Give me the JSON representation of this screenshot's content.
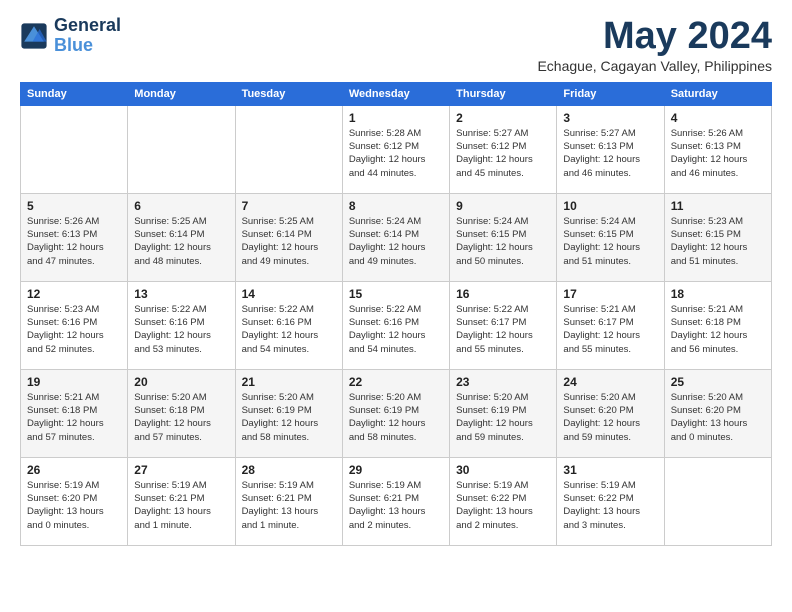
{
  "logo": {
    "line1": "General",
    "line2": "Blue"
  },
  "title": "May 2024",
  "subtitle": "Echague, Cagayan Valley, Philippines",
  "days_of_week": [
    "Sunday",
    "Monday",
    "Tuesday",
    "Wednesday",
    "Thursday",
    "Friday",
    "Saturday"
  ],
  "weeks": [
    [
      {
        "num": "",
        "sunrise": "",
        "sunset": "",
        "daylight": ""
      },
      {
        "num": "",
        "sunrise": "",
        "sunset": "",
        "daylight": ""
      },
      {
        "num": "",
        "sunrise": "",
        "sunset": "",
        "daylight": ""
      },
      {
        "num": "1",
        "sunrise": "5:28 AM",
        "sunset": "6:12 PM",
        "daylight": "12 hours and 44 minutes."
      },
      {
        "num": "2",
        "sunrise": "5:27 AM",
        "sunset": "6:12 PM",
        "daylight": "12 hours and 45 minutes."
      },
      {
        "num": "3",
        "sunrise": "5:27 AM",
        "sunset": "6:13 PM",
        "daylight": "12 hours and 46 minutes."
      },
      {
        "num": "4",
        "sunrise": "5:26 AM",
        "sunset": "6:13 PM",
        "daylight": "12 hours and 46 minutes."
      }
    ],
    [
      {
        "num": "5",
        "sunrise": "5:26 AM",
        "sunset": "6:13 PM",
        "daylight": "12 hours and 47 minutes."
      },
      {
        "num": "6",
        "sunrise": "5:25 AM",
        "sunset": "6:14 PM",
        "daylight": "12 hours and 48 minutes."
      },
      {
        "num": "7",
        "sunrise": "5:25 AM",
        "sunset": "6:14 PM",
        "daylight": "12 hours and 49 minutes."
      },
      {
        "num": "8",
        "sunrise": "5:24 AM",
        "sunset": "6:14 PM",
        "daylight": "12 hours and 49 minutes."
      },
      {
        "num": "9",
        "sunrise": "5:24 AM",
        "sunset": "6:15 PM",
        "daylight": "12 hours and 50 minutes."
      },
      {
        "num": "10",
        "sunrise": "5:24 AM",
        "sunset": "6:15 PM",
        "daylight": "12 hours and 51 minutes."
      },
      {
        "num": "11",
        "sunrise": "5:23 AM",
        "sunset": "6:15 PM",
        "daylight": "12 hours and 51 minutes."
      }
    ],
    [
      {
        "num": "12",
        "sunrise": "5:23 AM",
        "sunset": "6:16 PM",
        "daylight": "12 hours and 52 minutes."
      },
      {
        "num": "13",
        "sunrise": "5:22 AM",
        "sunset": "6:16 PM",
        "daylight": "12 hours and 53 minutes."
      },
      {
        "num": "14",
        "sunrise": "5:22 AM",
        "sunset": "6:16 PM",
        "daylight": "12 hours and 54 minutes."
      },
      {
        "num": "15",
        "sunrise": "5:22 AM",
        "sunset": "6:16 PM",
        "daylight": "12 hours and 54 minutes."
      },
      {
        "num": "16",
        "sunrise": "5:22 AM",
        "sunset": "6:17 PM",
        "daylight": "12 hours and 55 minutes."
      },
      {
        "num": "17",
        "sunrise": "5:21 AM",
        "sunset": "6:17 PM",
        "daylight": "12 hours and 55 minutes."
      },
      {
        "num": "18",
        "sunrise": "5:21 AM",
        "sunset": "6:18 PM",
        "daylight": "12 hours and 56 minutes."
      }
    ],
    [
      {
        "num": "19",
        "sunrise": "5:21 AM",
        "sunset": "6:18 PM",
        "daylight": "12 hours and 57 minutes."
      },
      {
        "num": "20",
        "sunrise": "5:20 AM",
        "sunset": "6:18 PM",
        "daylight": "12 hours and 57 minutes."
      },
      {
        "num": "21",
        "sunrise": "5:20 AM",
        "sunset": "6:19 PM",
        "daylight": "12 hours and 58 minutes."
      },
      {
        "num": "22",
        "sunrise": "5:20 AM",
        "sunset": "6:19 PM",
        "daylight": "12 hours and 58 minutes."
      },
      {
        "num": "23",
        "sunrise": "5:20 AM",
        "sunset": "6:19 PM",
        "daylight": "12 hours and 59 minutes."
      },
      {
        "num": "24",
        "sunrise": "5:20 AM",
        "sunset": "6:20 PM",
        "daylight": "12 hours and 59 minutes."
      },
      {
        "num": "25",
        "sunrise": "5:20 AM",
        "sunset": "6:20 PM",
        "daylight": "13 hours and 0 minutes."
      }
    ],
    [
      {
        "num": "26",
        "sunrise": "5:19 AM",
        "sunset": "6:20 PM",
        "daylight": "13 hours and 0 minutes."
      },
      {
        "num": "27",
        "sunrise": "5:19 AM",
        "sunset": "6:21 PM",
        "daylight": "13 hours and 1 minute."
      },
      {
        "num": "28",
        "sunrise": "5:19 AM",
        "sunset": "6:21 PM",
        "daylight": "13 hours and 1 minute."
      },
      {
        "num": "29",
        "sunrise": "5:19 AM",
        "sunset": "6:21 PM",
        "daylight": "13 hours and 2 minutes."
      },
      {
        "num": "30",
        "sunrise": "5:19 AM",
        "sunset": "6:22 PM",
        "daylight": "13 hours and 2 minutes."
      },
      {
        "num": "31",
        "sunrise": "5:19 AM",
        "sunset": "6:22 PM",
        "daylight": "13 hours and 3 minutes."
      },
      {
        "num": "",
        "sunrise": "",
        "sunset": "",
        "daylight": ""
      }
    ]
  ]
}
